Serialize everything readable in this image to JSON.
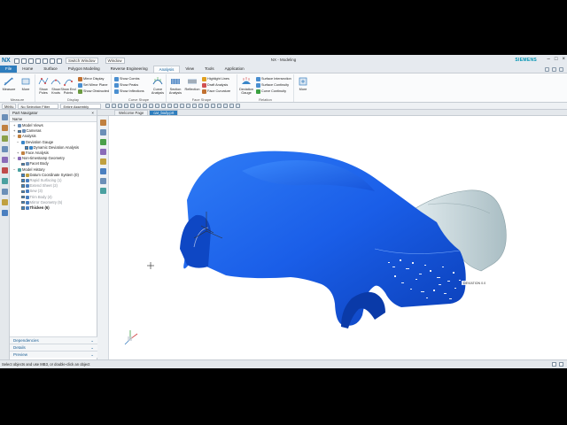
{
  "app": {
    "logo": "NX",
    "window_title": "NX - Modeling",
    "brand": "SIEMENS",
    "switch_window": "Switch Window",
    "window_menu": "Window"
  },
  "ribbon_tabs": [
    "File",
    "Home",
    "Surface",
    "Polygon Modeling",
    "Reverse Engineering",
    "Analysis",
    "View",
    "Tools",
    "Application"
  ],
  "active_tab": "Analysis",
  "groups": {
    "measure": {
      "label": "Measure",
      "buttons": [
        "Measure",
        "More"
      ]
    },
    "display": {
      "label": "Display",
      "buttons": [
        "Show Poles",
        "Show Knots",
        "Show End Points"
      ],
      "small": [
        "Mirror Display",
        "Set Mirror Plane",
        "Show Obstructed"
      ]
    },
    "curve_shape": {
      "label": "Curve Shape",
      "small": [
        "Show Combs",
        "Show Peaks",
        "Show Inflections"
      ],
      "buttons": [
        "Curve Analysis"
      ]
    },
    "face_shape": {
      "label": "Face Shape",
      "buttons": [
        "Section Analysis",
        "Reflection"
      ],
      "small": [
        "Highlight Lines",
        "Draft Analysis",
        "Face Curvature"
      ]
    },
    "relation": {
      "label": "Relation",
      "buttons": [
        "Deviation Gauge"
      ],
      "small": [
        "Surface Intersection",
        "Surface Continuity",
        "Curve Continuity"
      ]
    },
    "more": {
      "buttons": [
        "More"
      ]
    }
  },
  "selection_bar": {
    "menu": "Menu",
    "filter1": "No Selection Filter",
    "filter2": "Entire Assembly"
  },
  "part_navigator": {
    "title": "Part Navigator",
    "column": "Name",
    "nodes": [
      {
        "text": "Model Views",
        "indent": 1,
        "expand": "+",
        "check": false,
        "style": ""
      },
      {
        "text": "Cameras",
        "indent": 1,
        "expand": "+",
        "check": true,
        "style": ""
      },
      {
        "text": "Analysis",
        "indent": 1,
        "expand": "-",
        "check": false,
        "style": ""
      },
      {
        "text": "Deviation Gauge",
        "indent": 2,
        "expand": "-",
        "check": false,
        "style": ""
      },
      {
        "text": "Dynamic Deviation Analysis",
        "indent": 3,
        "expand": "",
        "check": true,
        "style": ""
      },
      {
        "text": "Face Analysis",
        "indent": 2,
        "expand": "+",
        "check": false,
        "style": ""
      },
      {
        "text": "Non-timestamp Geometry",
        "indent": 1,
        "expand": "-",
        "check": false,
        "style": ""
      },
      {
        "text": "Facet Body",
        "indent": 2,
        "expand": "",
        "check": true,
        "style": ""
      },
      {
        "text": "Model History",
        "indent": 1,
        "expand": "-",
        "check": false,
        "style": ""
      },
      {
        "text": "Datum Coordinate System (0)",
        "indent": 2,
        "expand": "",
        "check": true,
        "style": ""
      },
      {
        "text": "Rapid Surfacing (1)",
        "indent": 2,
        "expand": "",
        "check": true,
        "style": "dim"
      },
      {
        "text": "Extend Sheet (2)",
        "indent": 2,
        "expand": "",
        "check": true,
        "style": "dim"
      },
      {
        "text": "Sew (3)",
        "indent": 2,
        "expand": "",
        "check": true,
        "style": "dim"
      },
      {
        "text": "Trim Body (4)",
        "indent": 2,
        "expand": "",
        "check": true,
        "style": "dim"
      },
      {
        "text": "Mirror Geometry (5)",
        "indent": 2,
        "expand": "",
        "check": true,
        "style": "dim"
      },
      {
        "text": "Thicken (6)",
        "indent": 2,
        "expand": "",
        "check": true,
        "style": "bold"
      }
    ],
    "footer": [
      "Dependencies",
      "Details",
      "Preview"
    ]
  },
  "graphics": {
    "tabs": [
      "Welcome Page",
      "car_body.prt"
    ],
    "active_tab": "car_body.prt",
    "annotation": "DEVIATION 0.0"
  },
  "status": "Select objects and use MB3, or double-click an object",
  "colors": {
    "accent": "#2e7dbd",
    "car_body": "#1a5ee8",
    "facet_body": "#c9d9de"
  }
}
